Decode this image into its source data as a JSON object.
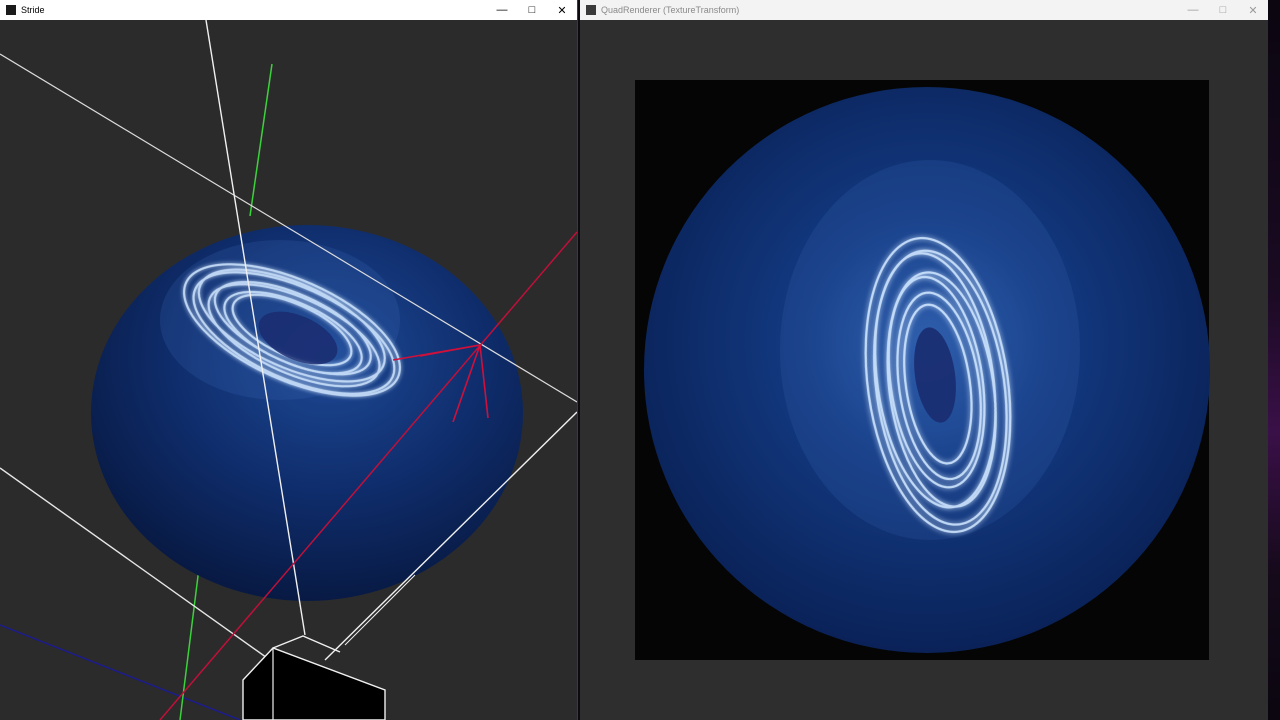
{
  "windows": {
    "stride": {
      "title": "Stride",
      "minimize_icon": "minimize-icon",
      "maximize_icon": "maximize-icon",
      "close_icon": "close-icon"
    },
    "quad": {
      "title": "QuadRenderer (TextureTransform)",
      "minimize_icon": "minimize-icon",
      "maximize_icon": "maximize-icon",
      "close_icon": "close-icon"
    }
  },
  "colors": {
    "axis_x": "#d0103a",
    "axis_y": "#3cd23c",
    "axis_z": "#1a1a8a",
    "sphere": "#0d2a66",
    "glow": "#bfe0ff",
    "viewport_bg": "#2b2b2b"
  }
}
